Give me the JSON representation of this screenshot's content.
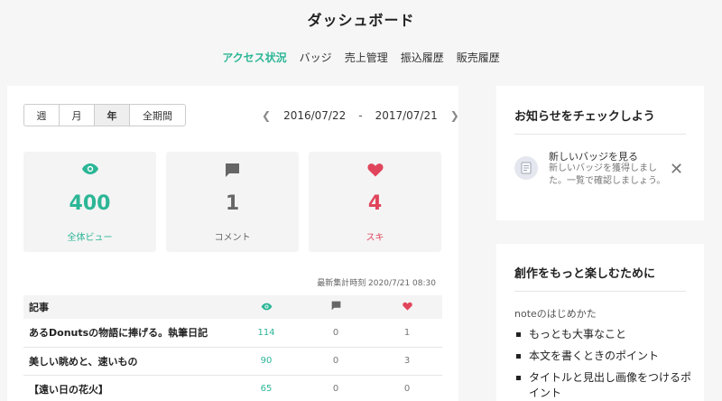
{
  "page_title": "ダッシュボード",
  "tabs": [
    "アクセス状況",
    "バッジ",
    "売上管理",
    "振込履歴",
    "販売履歴"
  ],
  "active_tab": 0,
  "period": {
    "options": [
      "週",
      "月",
      "年",
      "全期間"
    ],
    "active": 2
  },
  "daterange": {
    "start": "2016/07/22",
    "separator": "-",
    "end": "2017/07/21"
  },
  "stats": {
    "views": {
      "value": "400",
      "label": "全体ビュー",
      "color": "#2cb696",
      "icon": "eye-icon"
    },
    "comments": {
      "value": "1",
      "label": "コメント",
      "color": "#666666",
      "icon": "comment-icon"
    },
    "likes": {
      "value": "4",
      "label": "スキ",
      "color": "#e0455c",
      "icon": "heart-icon"
    }
  },
  "updated_at": "最新集計時刻 2020/7/21 08:30",
  "table": {
    "header_label": "記事",
    "header_icons": [
      "eye-icon",
      "comment-icon",
      "heart-icon"
    ],
    "rows": [
      {
        "title": "あるDonutsの物語に捧げる。執筆日記",
        "views": "114",
        "comments": "0",
        "likes": "1"
      },
      {
        "title": "美しい眺めと、速いもの",
        "views": "90",
        "comments": "0",
        "likes": "3"
      },
      {
        "title": "【遠い日の花火】",
        "views": "65",
        "comments": "0",
        "likes": "0"
      }
    ]
  },
  "notice": {
    "title": "お知らせをチェックしよう",
    "item_title": "新しいバッジを見る",
    "item_body": "新しいバッジを獲得しました。一覧で確認しましょう。"
  },
  "guide": {
    "title": "創作をもっと楽しむために",
    "subtitle": "noteのはじめかた",
    "items": [
      "もっとも大事なこと",
      "本文を書くときのポイント",
      "タイトルと見出し画像をつけるポイント"
    ]
  },
  "colors": {
    "accent": "#2cb696",
    "like": "#e0455c",
    "background": "#f5f6f5"
  }
}
